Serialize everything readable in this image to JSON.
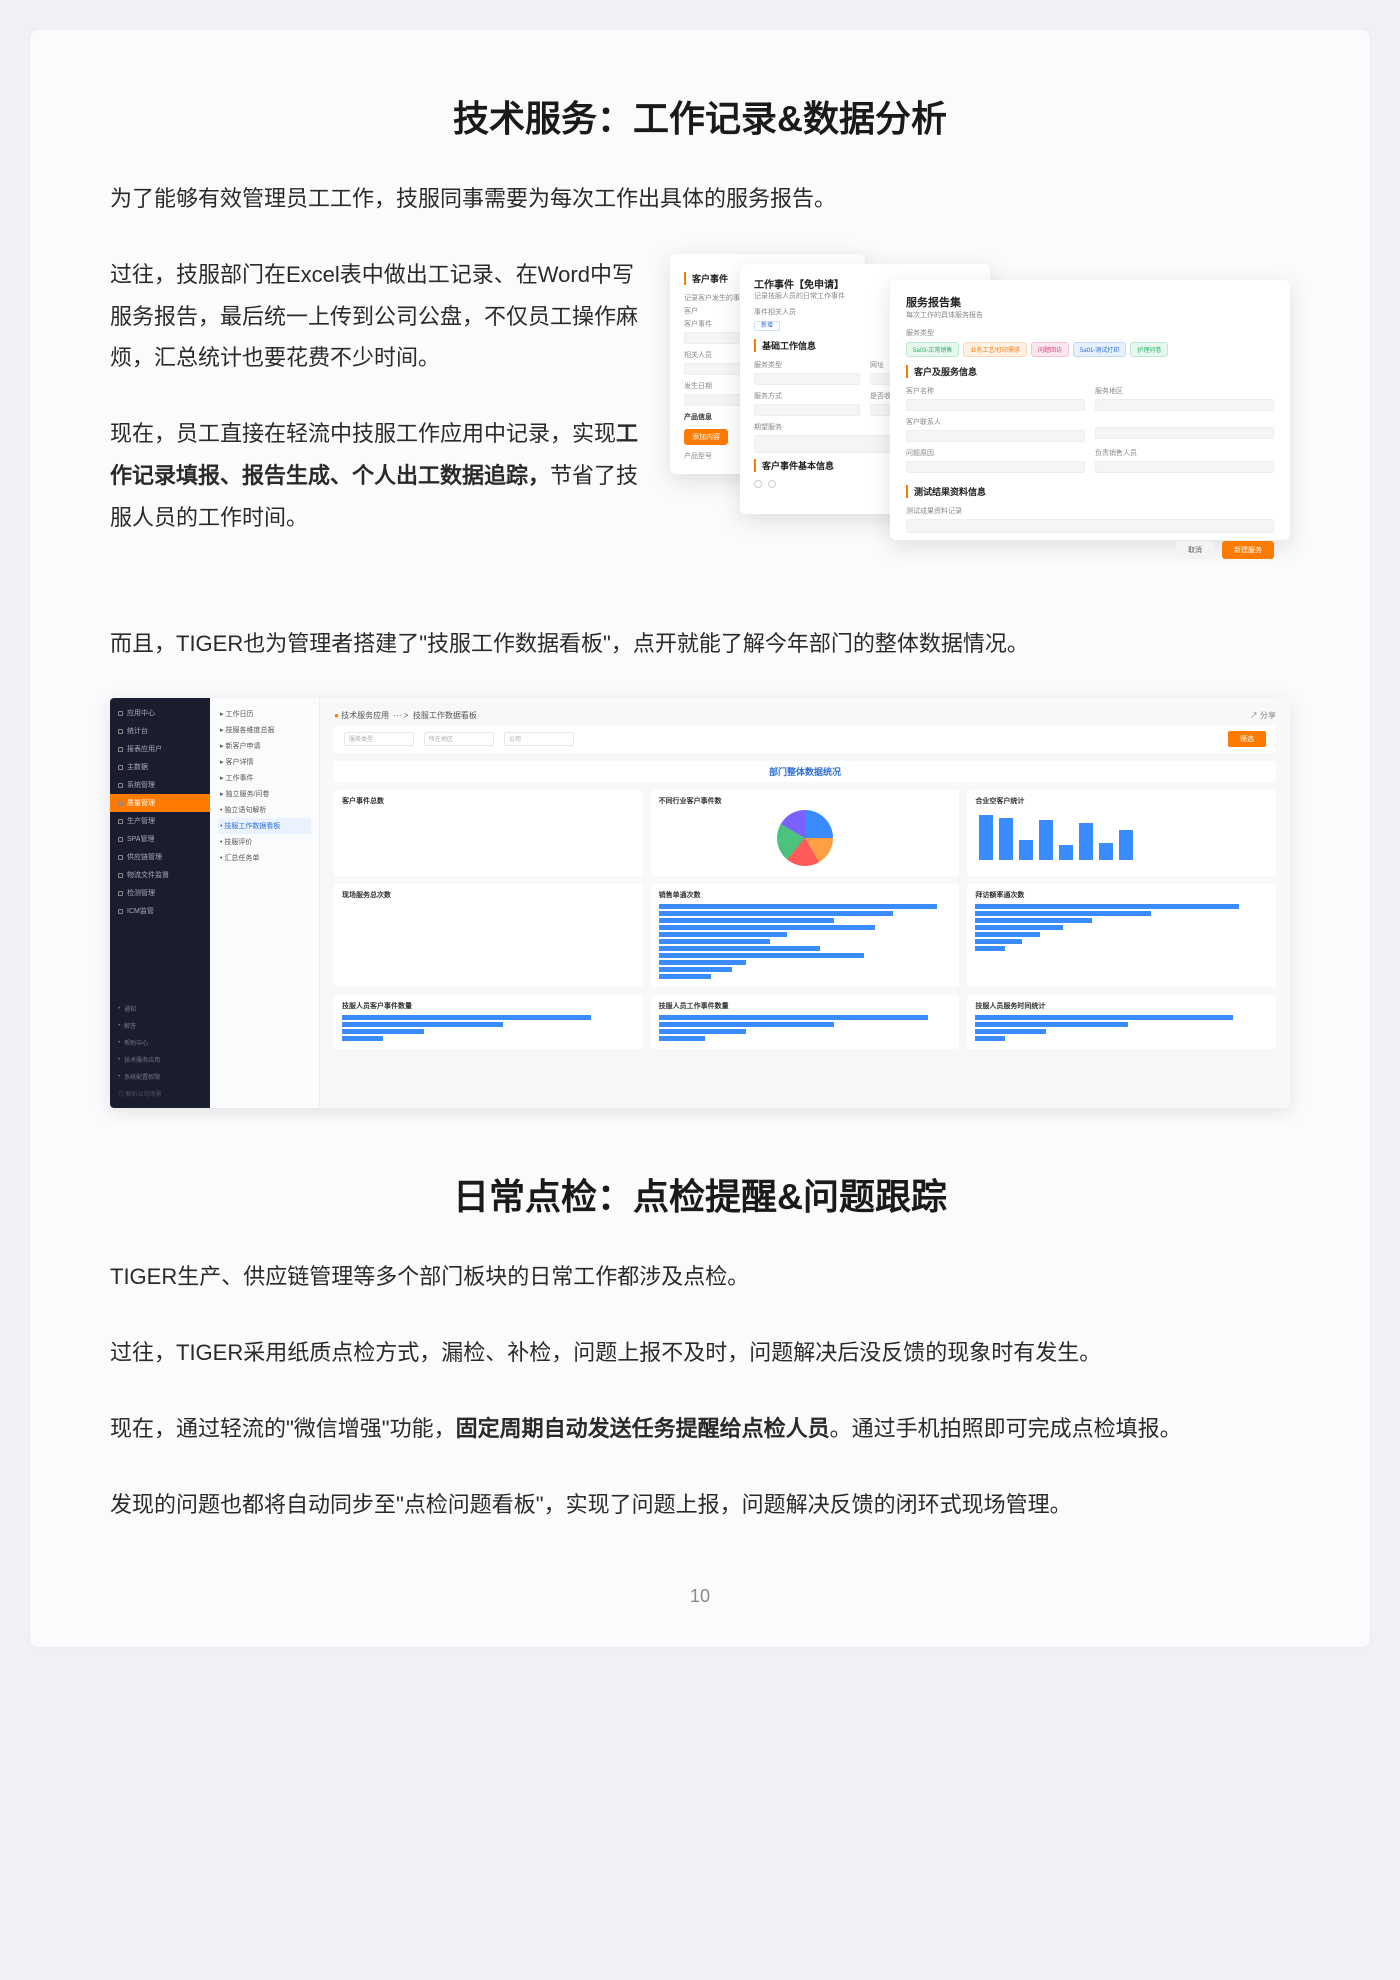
{
  "section1": {
    "title": "技术服务：工作记录&数据分析",
    "intro": "为了能够有效管理员工工作，技服同事需要为每次工作出具体的服务报告。",
    "para_past": "过往，技服部门在Excel表中做出工记录、在Word中写服务报告，最后统一上传到公司公盘，不仅员工操作麻烦，汇总统计也要花费不少时间。",
    "para_now_prefix": "现在，员工直接在轻流中技服工作应用中记录，实现",
    "para_now_bold": "工作记录填报、报告生成、个人出工数据追踪，",
    "para_now_suffix": "节省了技服人员的工作时间。",
    "para_dashboard": "而且，TIGER也为管理者搭建了\"技服工作数据看板\"，点开就能了解今年部门的整体数据情况。"
  },
  "shot1": {
    "back": {
      "h1": "客户事件",
      "sub": "记录客户发生的事件",
      "l_cust": "客户",
      "l_ev": "客户事件",
      "l_rel": "相关人员",
      "l_date": "发生日期",
      "l_info": "产品信息",
      "btn": "添加内容",
      "l_pz": "产品型号"
    },
    "mid": {
      "h1": "工作事件【免申请】",
      "sub": "记录技服人员的日常工作事件",
      "l_rel": "事件相关人员",
      "add": "新增",
      "sec_basic": "基础工作信息",
      "l_type": "服务类型",
      "l_way": "服务方式",
      "l_chg": "是否收费",
      "sec_cust": "客户事件基本信息",
      "l_note": "期望服务"
    },
    "front": {
      "h1": "服务报告集",
      "sub": "每次工作的具体服务报告",
      "l_svc": "服务类型",
      "tags": [
        "5a03-正常销售",
        "业务工艺/打印需求",
        "问题回访",
        "5a01-测试打印",
        "护理问卷"
      ],
      "sec_cust": "客户及服务信息",
      "l_custname": "客户名称",
      "l_area": "服务地区",
      "l_contact": "客户联系人",
      "l_reason": "问题原因",
      "l_resp": "负责销售人员",
      "sec_test": "测试结果资料信息",
      "l_testrec": "测试成果资料记录",
      "btn_cancel": "取消",
      "btn_submit": "新建服务"
    }
  },
  "nav": {
    "items": [
      "应用中心",
      "统计台",
      "报表应用户",
      "主数据",
      "系统管理",
      "质量管理",
      "生产管理",
      "SPA管理",
      "供应链管理",
      "物流文件监督",
      "检测管理",
      "ICM监管"
    ],
    "bottom": [
      "通知",
      "解答",
      "帮助中心",
      "技术服务应用",
      "系统配置权限"
    ],
    "footer": "解析公司场景"
  },
  "tree": {
    "items": [
      "工作日历",
      "技服各维度总报",
      "新客户申请",
      "客户详情",
      "工作事件",
      "独立服务/问卷",
      "独立语句解析",
      "技服工作数据看板",
      "技服评价",
      "汇总任务单"
    ]
  },
  "dash": {
    "crumb_a": "技术服务应用",
    "crumb_b": "技服工作数据看板",
    "share": "分享",
    "f1": "服务类型",
    "f2": "所在地区",
    "f3": "公司",
    "btn": "筛选",
    "band": "部门整体数据统况",
    "p": [
      "客户事件总数",
      "不同行业客户事件数",
      "合业空客户统计",
      "现场服务总次数",
      "销售单通次数",
      "拜访额率通次数",
      "技服人员客户事件数量",
      "技服人员工作事件数量",
      "技服人员服务时间统计"
    ]
  },
  "chart_data": [
    {
      "type": "number",
      "title": "客户事件总数"
    },
    {
      "type": "pie",
      "title": "不同行业客户事件数",
      "slices": [
        {
          "color": "#3a8bff",
          "deg": 90
        },
        {
          "color": "#ff9f43",
          "deg": 60
        },
        {
          "color": "#ff5b5b",
          "deg": 70
        },
        {
          "color": "#4bc27d",
          "deg": 80
        },
        {
          "color": "#7b61ff",
          "deg": 60
        }
      ]
    },
    {
      "type": "bar",
      "title": "合业空客户统计",
      "values": [
        90,
        85,
        40,
        80,
        30,
        75,
        35,
        60
      ]
    },
    {
      "type": "number",
      "title": "现场服务总次数"
    },
    {
      "type": "hbar",
      "title": "销售单通次数",
      "values": [
        95,
        80,
        60,
        74,
        44,
        38,
        55,
        70,
        30,
        25,
        18
      ]
    },
    {
      "type": "hbar",
      "title": "拜访额率通次数",
      "values": [
        90,
        60,
        40,
        30,
        22,
        16,
        10
      ]
    },
    {
      "type": "hbar",
      "title": "技服人员客户事件数量",
      "values": [
        85,
        55,
        28,
        14
      ]
    },
    {
      "type": "hbar",
      "title": "技服人员工作事件数量",
      "values": [
        92,
        60,
        30,
        16
      ]
    },
    {
      "type": "hbar",
      "title": "技服人员服务时间统计",
      "values": [
        88,
        52,
        24,
        10
      ]
    }
  ],
  "section2": {
    "title": "日常点检：点检提醒&问题跟踪",
    "p1": "TIGER生产、供应链管理等多个部门板块的日常工作都涉及点检。",
    "p2": "过往，TIGER采用纸质点检方式，漏检、补检，问题上报不及时，问题解决后没反馈的现象时有发生。",
    "p3_prefix": "现在，通过轻流的\"微信增强\"功能，",
    "p3_bold": "固定周期自动发送任务提醒给点检人员",
    "p3_suffix": "。通过手机拍照即可完成点检填报。",
    "p4": "发现的问题也都将自动同步至\"点检问题看板\"，实现了问题上报，问题解决反馈的闭环式现场管理。"
  },
  "page_number": "10"
}
